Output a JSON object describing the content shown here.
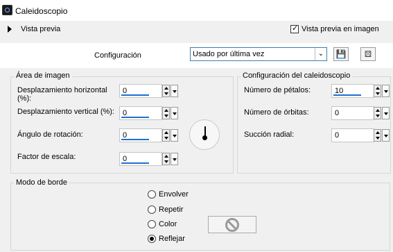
{
  "window": {
    "title": "Caleidoscopio"
  },
  "preview": {
    "toggle_label": "Vista previa",
    "in_image_label": "Vista previa en imagen",
    "in_image_checked": true
  },
  "config": {
    "label": "Configuración",
    "preset_value": "Usado por última vez",
    "save_icon": "save-icon",
    "random_icon": "dice-icon"
  },
  "image_area": {
    "title": "Área de imagen",
    "h_offset": {
      "label": "Desplazamiento horizontal (%):",
      "value": "0"
    },
    "v_offset": {
      "label": "Desplazamiento vertical (%):",
      "value": "0"
    },
    "rotation": {
      "label": "Ángulo de rotación:",
      "value": "0"
    },
    "scale": {
      "label": "Factor de escala:",
      "value": "0"
    }
  },
  "kaleido": {
    "title": "Configuración del caleidoscopio",
    "petals": {
      "label": "Número de pétalos:",
      "value": "10"
    },
    "orbits": {
      "label": "Número de órbitas:",
      "value": "0"
    },
    "radial": {
      "label": "Succión radial:",
      "value": "0"
    }
  },
  "edge_mode": {
    "title": "Modo de borde",
    "options": [
      {
        "label": "Envolver",
        "selected": false
      },
      {
        "label": "Repetir",
        "selected": false
      },
      {
        "label": "Color",
        "selected": false
      },
      {
        "label": "Reflejar",
        "selected": true
      }
    ]
  }
}
